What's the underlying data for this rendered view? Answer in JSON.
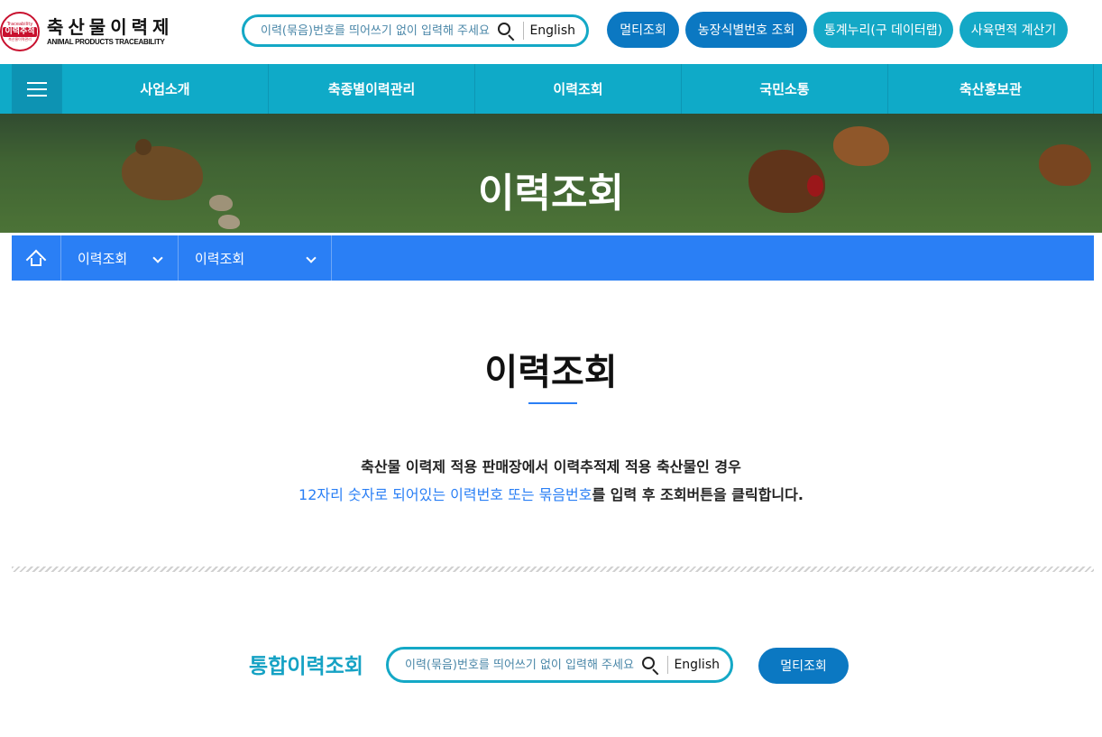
{
  "header": {
    "logo_seal_top": "Traceability",
    "logo_seal_mid": "이력추적",
    "logo_seal_bot": "축산물이력관리",
    "logo_title": "축산물이력제",
    "logo_subtitle": "ANIMAL PRODUCTS TRACEABILITY",
    "search_placeholder": "이력(묶음)번호를 띄어쓰기 없이 입력해 주세요",
    "lang_label": "English",
    "buttons": {
      "multi": "멀티조회",
      "farm_id": "농장식별번호 조회",
      "stats": "통계누리(구 데이터랩)",
      "area_calc": "사육면적 계산기"
    }
  },
  "nav": {
    "items": [
      "사업소개",
      "축종별이력관리",
      "이력조회",
      "국민소통",
      "축산홍보관"
    ]
  },
  "hero": {
    "title": "이력조회"
  },
  "breadcrumb": {
    "level1": "이력조회",
    "level2": "이력조회"
  },
  "main": {
    "title": "이력조회",
    "desc_line1": "축산물 이력제 적용 판매장에서 이력추적제 적용 축산물인 경우",
    "desc_line2_part1": "12자리 숫자로 되어있는 이력번호 또는 묶음번호",
    "desc_line2_part2": "를 입력 후 조회버튼을 클릭합니다."
  },
  "integrated": {
    "title": "통합이력조회",
    "search_placeholder": "이력(묶음)번호를 띄어쓰기 없이 입력해 주세요",
    "lang_label": "English",
    "multi_button": "멀티조회"
  },
  "colors": {
    "teal": "#0faac8",
    "blue": "#2a7ff5",
    "button_blue": "#0b78c2"
  }
}
